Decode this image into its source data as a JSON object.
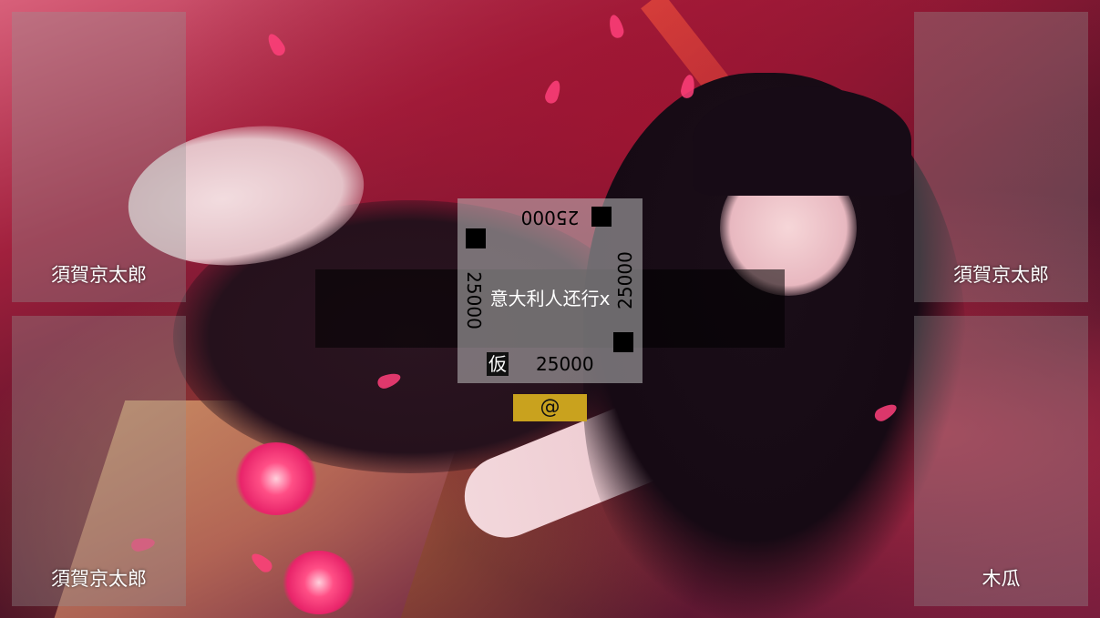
{
  "players": {
    "top_left": {
      "name": "須賀京太郎"
    },
    "bottom_left": {
      "name": "須賀京太郎"
    },
    "top_right": {
      "name": "須賀京太郎"
    },
    "bottom_right": {
      "name": "木瓜"
    }
  },
  "table": {
    "round_info": "意大利人还行x",
    "scores": {
      "top": "25000",
      "left": "25000",
      "right": "25000",
      "bottom": "25000"
    },
    "dealer_label": "仮"
  },
  "action_button": {
    "label": "@"
  },
  "colors": {
    "action_button": "#c9a21e",
    "panel": "rgba(150,150,150,0.35)",
    "info_bar": "rgba(0,0,0,0.55)"
  }
}
